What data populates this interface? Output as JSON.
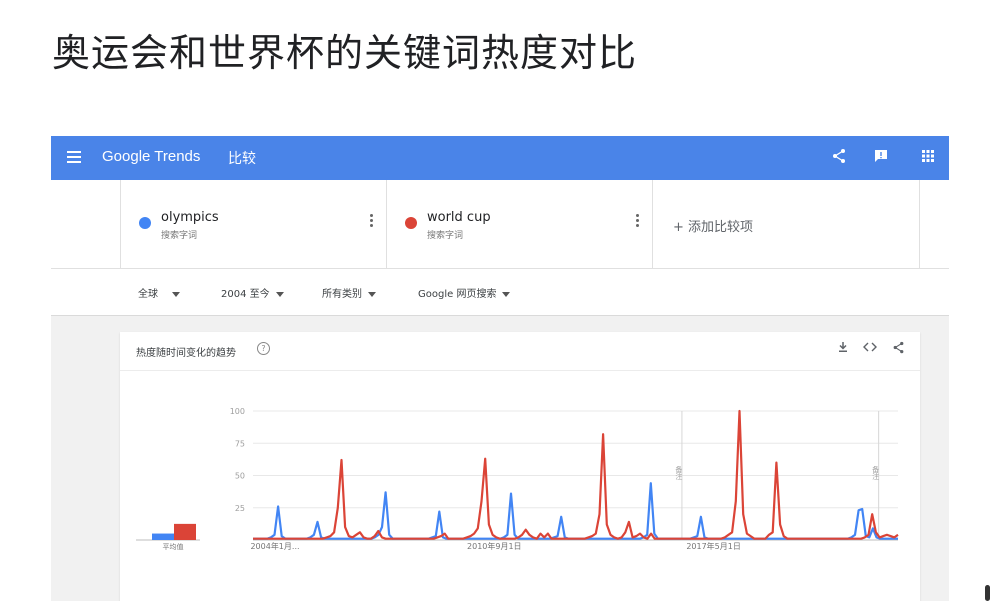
{
  "slide_title": "奥运会和世界杯的关键词热度对比",
  "header": {
    "brand": "Google Trends",
    "section": "比较",
    "icons": [
      "share-icon",
      "feedback-icon",
      "apps-icon"
    ]
  },
  "terms": [
    {
      "name": "olympics",
      "sub": "搜索字词",
      "color": "#4285f4"
    },
    {
      "name": "world cup",
      "sub": "搜索字词",
      "color": "#db4437"
    }
  ],
  "add_compare": "+ 添加比较项",
  "filters": {
    "region": "全球",
    "time": "2004 至今",
    "category": "所有类别",
    "type": "Google 网页搜索"
  },
  "card": {
    "title": "热度随时间变化的趋势",
    "help": "?",
    "icons": [
      "download-icon",
      "embed-icon",
      "share-icon"
    ]
  },
  "chart_data": {
    "type": "line",
    "y_ticks": [
      "100",
      "75",
      "50",
      "25"
    ],
    "ylim": [
      0,
      100
    ],
    "x_ticks": [
      "2004年1月...",
      "2010年9月1日",
      "2017年5月1日"
    ],
    "x_ticks_pos": [
      0,
      0.34,
      0.68
    ],
    "avg_label": "平均值",
    "averages": [
      2,
      5
    ],
    "note_label": "备注",
    "note_positions": [
      0.665,
      0.97
    ],
    "series": [
      {
        "name": "olympics",
        "color": "#4285f4",
        "values": [
          1,
          1,
          1,
          1,
          1,
          2,
          4,
          26,
          3,
          1,
          1,
          1,
          1,
          1,
          1,
          1,
          2,
          4,
          14,
          2,
          1,
          1,
          1,
          1,
          1,
          1,
          1,
          1,
          1,
          1,
          1,
          1,
          1,
          1,
          2,
          4,
          10,
          37,
          4,
          1,
          1,
          1,
          1,
          1,
          1,
          1,
          1,
          1,
          1,
          1,
          2,
          3,
          22,
          2,
          1,
          1,
          1,
          1,
          1,
          1,
          1,
          1,
          1,
          1,
          1,
          1,
          1,
          1,
          1,
          1,
          2,
          4,
          36,
          4,
          1,
          1,
          1,
          1,
          1,
          1,
          1,
          1,
          1,
          1,
          2,
          3,
          18,
          2,
          1,
          1,
          1,
          1,
          1,
          1,
          1,
          1,
          1,
          1,
          1,
          1,
          1,
          1,
          1,
          1,
          1,
          1,
          1,
          1,
          1,
          2,
          4,
          44,
          5,
          1,
          1,
          1,
          1,
          1,
          1,
          1,
          1,
          1,
          1,
          2,
          3,
          18,
          2,
          1,
          1,
          1,
          1,
          1,
          1,
          1,
          1,
          1,
          1,
          1,
          1,
          1,
          1,
          1,
          1,
          1,
          1,
          1,
          1,
          1,
          1,
          1,
          1,
          1,
          1,
          1,
          1,
          1,
          1,
          1,
          1,
          1,
          1,
          1,
          1,
          1,
          1,
          1,
          1,
          2,
          4,
          23,
          24,
          3,
          2,
          9,
          2,
          1,
          1,
          1,
          1,
          1,
          1
        ]
      },
      {
        "name": "world cup",
        "color": "#db4437",
        "values": [
          1,
          1,
          1,
          1,
          1,
          1,
          1,
          1,
          1,
          1,
          1,
          1,
          1,
          1,
          1,
          1,
          1,
          1,
          1,
          1,
          2,
          3,
          6,
          25,
          62,
          10,
          3,
          2,
          4,
          6,
          2,
          1,
          1,
          3,
          7,
          2,
          1,
          1,
          1,
          1,
          1,
          1,
          1,
          1,
          1,
          1,
          1,
          1,
          1,
          1,
          2,
          3,
          5,
          1,
          1,
          1,
          1,
          1,
          2,
          3,
          5,
          9,
          30,
          63,
          12,
          4,
          2,
          1,
          1,
          1,
          1,
          1,
          2,
          4,
          8,
          4,
          2,
          1,
          5,
          2,
          5,
          1,
          1,
          1,
          1,
          1,
          1,
          1,
          1,
          1,
          1,
          2,
          3,
          5,
          20,
          82,
          12,
          4,
          2,
          1,
          2,
          6,
          14,
          2,
          3,
          5,
          2,
          1,
          5,
          1,
          1,
          1,
          1,
          1,
          1,
          1,
          1,
          1,
          1,
          1,
          1,
          1,
          1,
          1,
          1,
          1,
          1,
          1,
          2,
          4,
          6,
          30,
          100,
          20,
          5,
          3,
          1,
          1,
          1,
          1,
          4,
          6,
          60,
          12,
          3,
          1,
          1,
          1,
          1,
          1,
          1,
          1,
          1,
          1,
          1,
          1,
          1,
          1,
          1,
          1,
          1,
          1,
          1,
          1,
          1,
          1,
          2,
          4,
          20,
          6,
          2,
          3,
          4,
          3,
          2,
          4
        ]
      }
    ]
  }
}
